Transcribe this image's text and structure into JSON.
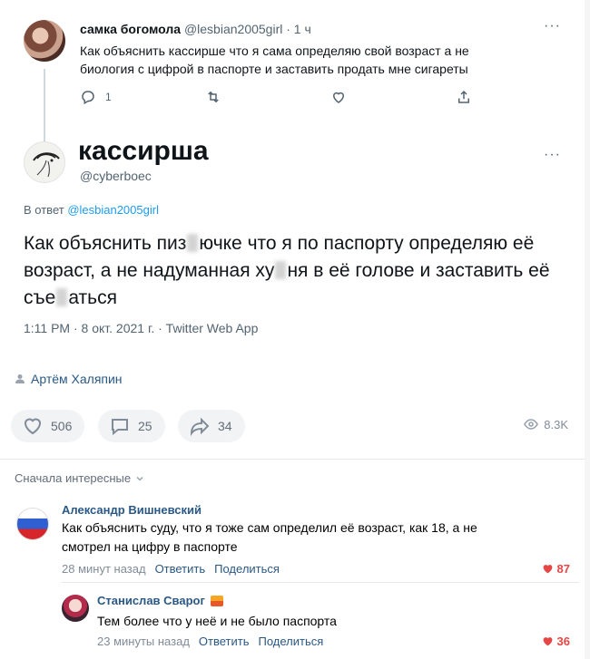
{
  "reply_tweet": {
    "name": "самка богомола",
    "handle_time": " @lesbian2005girl · 1 ч",
    "text": "Как объяснить кассирше что я сама определяю свой возраст а не биология с цифрой в паспорте и заставить продать мне сигареты",
    "reply_count": "1"
  },
  "main_tweet": {
    "name": "кассирша",
    "handle": "@cyberboec",
    "replying_prefix": "В ответ ",
    "replying_to": "@lesbian2005girl",
    "text_part1": "Как объяснить пиз",
    "text_part2": "ючке что я по паспорту определяю её возраст, а не надуманная ху",
    "text_part3": "ня в её голове и заставить её съе",
    "text_part4": "аться",
    "meta": "1:11 PM · 8 окт. 2021 г. · Twitter Web App"
  },
  "post": {
    "author": "Артём Халяпин",
    "likes": "506",
    "comments": "25",
    "shares": "34",
    "views": "8.3K"
  },
  "comments_section": {
    "sort_label": "Сначала интересные",
    "items": [
      {
        "name": "Александр Вишневский",
        "text": "Как объяснить суду, что я тоже сам определил её возраст, как 18, а не смотрел на цифру в паспорте",
        "time": "28 минут назад",
        "reply": "Ответить",
        "share": "Поделиться",
        "likes": "87"
      },
      {
        "name": "Станислав Сварог",
        "text": "Тем более что у неё и не было паспорта",
        "time": "23 минуты назад",
        "reply": "Ответить",
        "share": "Поделиться",
        "likes": "36"
      }
    ]
  },
  "colors": {
    "vk_link": "#2a5885",
    "twitter_link": "#1d9bf0",
    "like_red": "#e64646",
    "pill_bg": "#f2f3f5"
  }
}
